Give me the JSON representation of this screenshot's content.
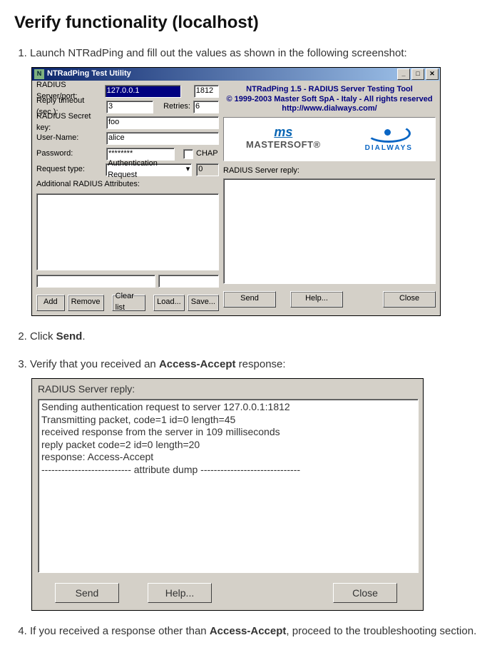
{
  "heading": "Verify functionality (localhost)",
  "steps": {
    "s1": "Launch NTRadPing and fill out the values as shown in the following screenshot:",
    "s2a": "Click ",
    "s2b": "Send",
    "s2c": ".",
    "s3a": "Verify that you received an ",
    "s3b": "Access-Accept",
    "s3c": " response:",
    "s4a": "If you received a response other than ",
    "s4b": "Access-Accept",
    "s4c": ", proceed to the troubleshooting section."
  },
  "win1": {
    "title": "NTRadPing Test Utility",
    "labels": {
      "server": "RADIUS Server/port:",
      "timeout": "Reply timeout (sec.):",
      "retries": "Retries:",
      "secret": "RADIUS Secret key:",
      "user": "User-Name:",
      "password": "Password:",
      "chap": "CHAP",
      "reqtype": "Request type:",
      "addl": "Additional RADIUS Attributes:",
      "reply": "RADIUS Server reply:"
    },
    "values": {
      "server": "127.0.0.1",
      "port": "1812",
      "timeout": "3",
      "retries": "6",
      "secret": "foo",
      "user": "alice",
      "password": "********",
      "reqtype": "Authentication Request",
      "reqnum": "0"
    },
    "buttons": {
      "add": "Add",
      "remove": "Remove",
      "clear": "Clear list",
      "load": "Load...",
      "save": "Save...",
      "send": "Send",
      "help": "Help...",
      "close": "Close"
    },
    "info": {
      "l1": "NTRadPing 1.5 - RADIUS Server Testing Tool",
      "l2": "© 1999-2003 Master Soft SpA - Italy - All rights reserved",
      "l3": "http://www.dialways.com/"
    },
    "logos": {
      "ms_script": "ms",
      "ms_lower": "MASTERSOFT®",
      "dw": "DIALWAYS"
    }
  },
  "win2": {
    "title": "RADIUS Server reply:",
    "lines": "Sending authentication request to server 127.0.0.1:1812\nTransmitting packet, code=1 id=0 length=45\nreceived response from the server in 109 milliseconds\nreply packet code=2 id=0 length=20\nresponse: Access-Accept\n--------------------------- attribute dump ------------------------------",
    "buttons": {
      "send": "Send",
      "help": "Help...",
      "close": "Close"
    }
  }
}
